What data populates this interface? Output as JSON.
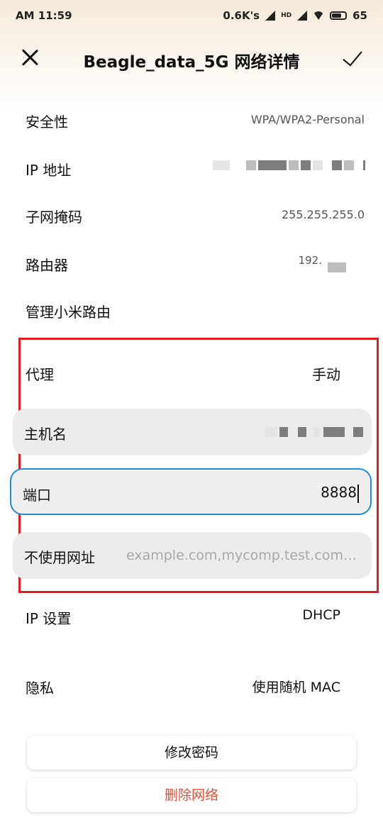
{
  "status_bar": {
    "time": "AM 11:59",
    "speed": "0.6K's",
    "hd": "HD",
    "battery": "65"
  },
  "header": {
    "title": "Beagle_data_5G 网络详情"
  },
  "details": {
    "security_label": "安全性",
    "security_value": "WPA/WPA2-Personal",
    "ip_label": "IP 地址",
    "subnet_label": "子网掩码",
    "subnet_value": "255.255.255.0",
    "router_label": "路由器",
    "router_value": "192.",
    "manage_label": "管理小米路由"
  },
  "proxy": {
    "label": "代理",
    "value": "手动",
    "host_label": "主机名",
    "port_label": "端口",
    "port_value": "8888",
    "bypass_label": "不使用网址",
    "bypass_placeholder": "example.com,mycomp.test.com,localhost"
  },
  "ip_settings": {
    "label": "IP 设置",
    "value": "DHCP"
  },
  "privacy": {
    "label": "隐私",
    "value": "使用随机 MAC"
  },
  "buttons": {
    "modify_password": "修改密码",
    "delete_network": "删除网络"
  },
  "colors": {
    "highlight_border": "#e11d1d",
    "focus_border": "#1d8cdc",
    "danger_text": "#e0503a"
  }
}
